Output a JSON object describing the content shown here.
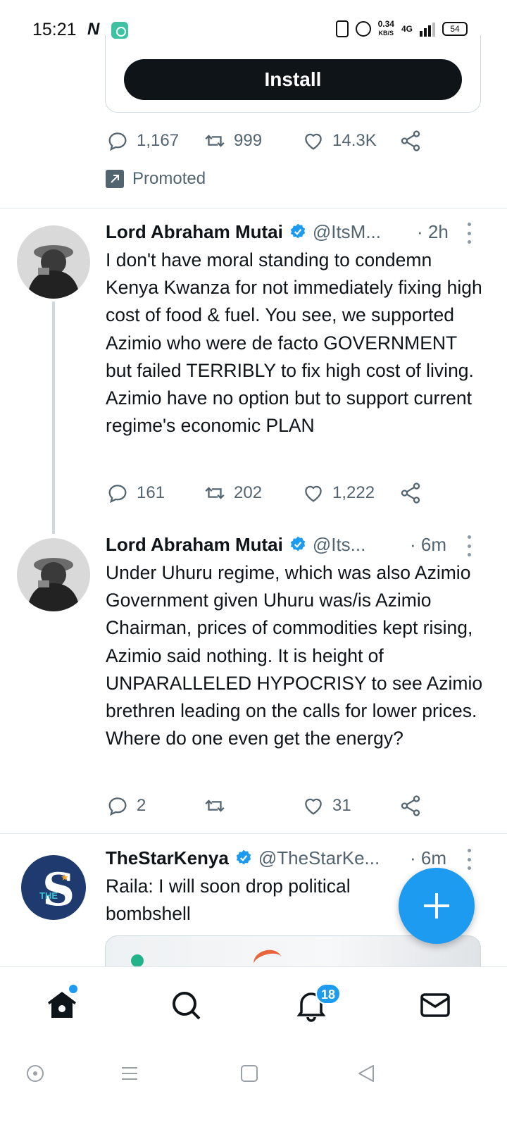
{
  "status_bar": {
    "time": "15:21",
    "notif_icon_1": "N",
    "speed_value": "0.34",
    "speed_unit": "KB/S",
    "network": "4G",
    "battery": "54"
  },
  "ad": {
    "install_label": "Install",
    "replies": "1,167",
    "retweets": "999",
    "likes": "14.3K",
    "promoted_label": "Promoted"
  },
  "tweets": [
    {
      "name": "Lord Abraham Mutai",
      "handle": "@ItsM...",
      "time": "· 2h",
      "text": "I don't have moral standing to condemn Kenya Kwanza for not immediately fixing high cost of food & fuel. You see, we supported Azimio who were de facto GOVERNMENT but failed TERRIBLY to fix high cost of living. Azimio have no option but to support current regime's economic PLAN",
      "replies": "161",
      "retweets": "202",
      "likes": "1,222"
    },
    {
      "name": "Lord Abraham Mutai",
      "handle": "@Its...",
      "time": "· 6m",
      "text": "Under Uhuru regime, which was also Azimio Government given Uhuru was/is Azimio Chairman, prices of commodities kept rising, Azimio said nothing. It is height of UNPARALLELED HYPOCRISY to see Azimio brethren leading on the calls for lower prices. Where do one even get the energy?",
      "replies": "2",
      "retweets": "",
      "likes": "31"
    },
    {
      "name": "TheStarKenya",
      "handle": "@TheStarKe...",
      "time": "· 6m",
      "text": "Raila: I will soon drop political bombshell",
      "avatar_letter": "S",
      "avatar_small": "THE"
    }
  ],
  "bottom_nav": {
    "notifications_badge": "18"
  },
  "colors": {
    "accent": "#1d9bf0",
    "text_primary": "#0f1419",
    "text_secondary": "#536471"
  }
}
